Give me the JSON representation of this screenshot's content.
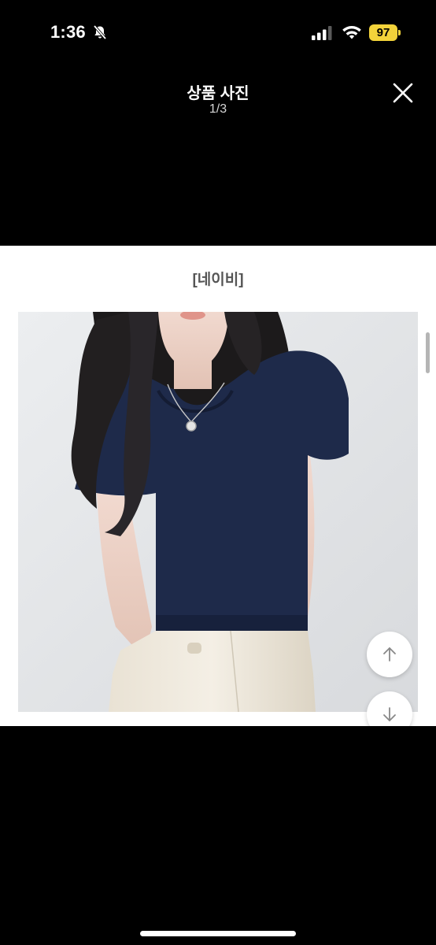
{
  "status_bar": {
    "time": "1:36",
    "battery": "97",
    "icons": [
      "bell-slash-icon",
      "cellular-signal-icon",
      "wifi-icon",
      "battery-icon"
    ],
    "battery_color": "#f3d33a"
  },
  "viewer": {
    "title": "상품 사진",
    "counter": "1/3",
    "close_icon": "close-icon"
  },
  "content": {
    "caption": "[네이비]",
    "photo_subject": "product-photo",
    "scroll_up_icon": "arrow-up-icon",
    "scroll_down_icon": "arrow-down-icon"
  },
  "colors": {
    "background": "#000000",
    "content_background": "#ffffff",
    "sweater": "#1e2a4a"
  }
}
